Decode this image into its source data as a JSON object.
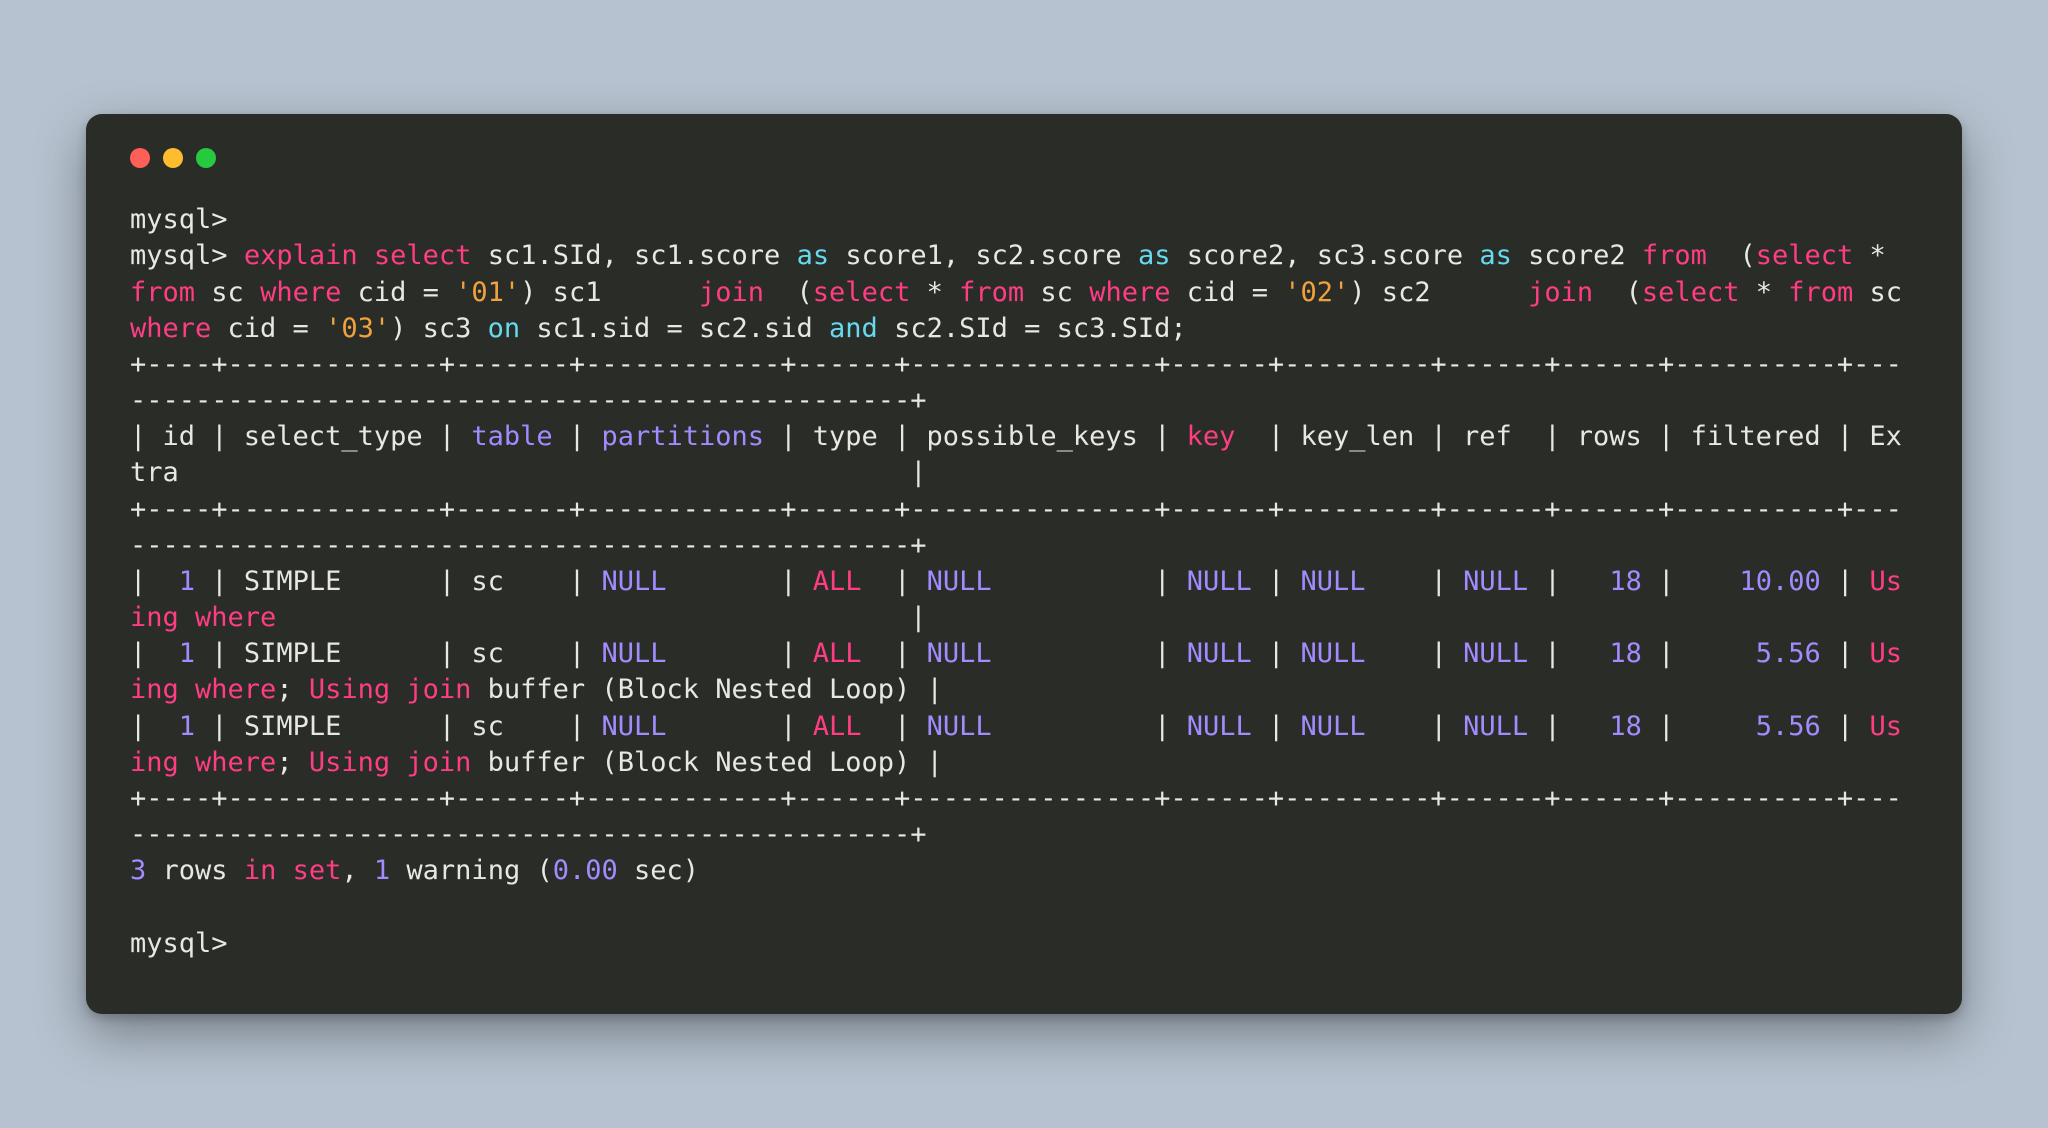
{
  "prompts": {
    "mysql": "mysql>"
  },
  "query": {
    "explain": "explain",
    "select": "select",
    "sc1_sid": "sc1.SId, sc1.",
    "score": "score ",
    "as": "as",
    "score1_label": " score1, sc2.",
    "score2_label": " score2, sc3.",
    "score2b_label": " score2 ",
    "from": "from",
    "paren_open": "(",
    "star_from": " * ",
    "sc_where": " sc ",
    "where": "where",
    "cid_eq": " cid = ",
    "lit01": "'01'",
    "sc1_alias": ") sc1      ",
    "join": "join",
    "lit02": "'02'",
    "sc2_alias": ") sc2      ",
    "lit03": "'03'",
    "sc3_alias": ") sc3 ",
    "on": "on",
    "sc1sid_eq": " sc1.sid = sc2.sid ",
    "and": "and",
    "sc2sid_eq": " sc2.SId = sc3.SId;"
  },
  "rule1": "+----+-------------+-------+------------+------+---------------+------+---------+------+------+----------+---------------------------------------------------+",
  "rule2": "+----+-------------+-------+------------+------+---------------+------+---------+------+------+----------+---------------------------------------------------+",
  "rule3": "+----+-------------+-------+------------+------+---------------+------+---------+------+------+----------+---------------------------------------------------+",
  "header": {
    "lead": "| id | select_type | ",
    "table": "table",
    "mid1": " | ",
    "partitions": "partitions",
    "mid2": " | type | possible_keys | ",
    "key": "key",
    "mid3": "  | key_len | ref  | rows | filtered | Extra                                             |"
  },
  "rows": [
    {
      "lead": "|  ",
      "id": "1",
      "mid_a": " | SIMPLE      | sc    | ",
      "null1": "NULL",
      "mid_b": "       | ",
      "all": "ALL",
      "mid_c": "  | ",
      "null2": "NULL",
      "mid_d": "          | ",
      "null3": "NULL",
      "mid_e": " | ",
      "null4": "NULL",
      "mid_f": "    | ",
      "null5": "NULL",
      "mid_g": " |   ",
      "rowcount": "18",
      "mid_h": " |    ",
      "filtered": "10.00",
      "mid_i": " | ",
      "using_where": "Using where",
      "tail": "                                       |"
    },
    {
      "lead": "|  ",
      "id": "1",
      "mid_a": " | SIMPLE      | sc    | ",
      "null1": "NULL",
      "mid_b": "       | ",
      "all": "ALL",
      "mid_c": "  | ",
      "null2": "NULL",
      "mid_d": "          | ",
      "null3": "NULL",
      "mid_e": " | ",
      "null4": "NULL",
      "mid_f": "    | ",
      "null5": "NULL",
      "mid_g": " |   ",
      "rowcount": "18",
      "mid_h": " |     ",
      "filtered": "5.56",
      "mid_i": " | ",
      "using_where": "Using where",
      "semi": "; ",
      "using_join": "Using join",
      "buf": " buffer (Block Nested Loop) |"
    },
    {
      "lead": "|  ",
      "id": "1",
      "mid_a": " | SIMPLE      | sc    | ",
      "null1": "NULL",
      "mid_b": "       | ",
      "all": "ALL",
      "mid_c": "  | ",
      "null2": "NULL",
      "mid_d": "          | ",
      "null3": "NULL",
      "mid_e": " | ",
      "null4": "NULL",
      "mid_f": "    | ",
      "null5": "NULL",
      "mid_g": " |   ",
      "rowcount": "18",
      "mid_h": " |     ",
      "filtered": "5.56",
      "mid_i": " | ",
      "using_where": "Using where",
      "semi": "; ",
      "using_join": "Using join",
      "buf": " buffer (Block Nested Loop) |"
    }
  ],
  "footer": {
    "n3": "3",
    "rows_word": " rows ",
    "in": "in",
    "set_word": " ",
    "set": "set",
    "comma": ", ",
    "n1": "1",
    "warning": " warning (",
    "time": "0.00",
    "sec": " sec)"
  }
}
